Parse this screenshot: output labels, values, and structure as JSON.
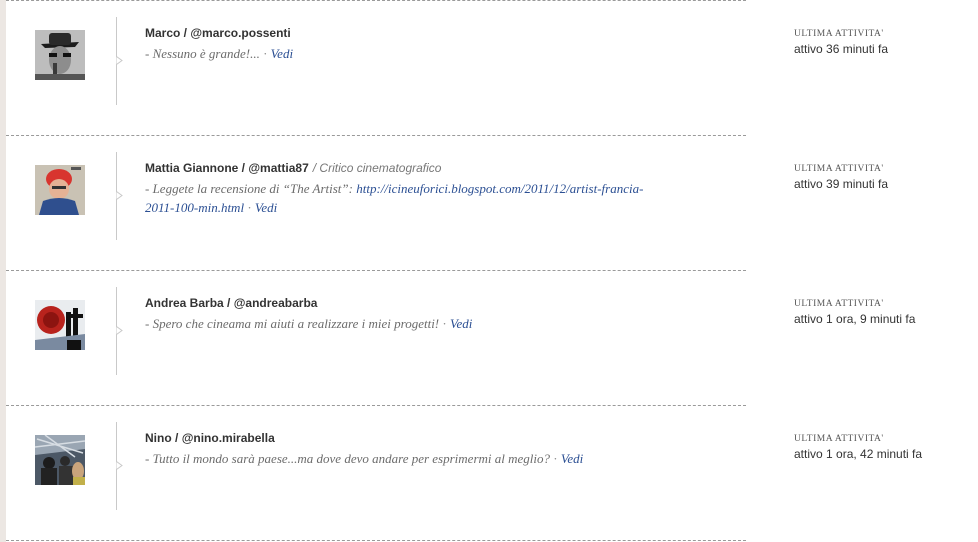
{
  "feed": {
    "activity_label": "ULTIMA ATTIVITA'",
    "items": [
      {
        "name": "Marco",
        "username": "@marco.possenti",
        "role": "",
        "message": "- Nessuno è grande!...",
        "link": "",
        "link_tail": "",
        "sep": "·",
        "view_label": "Vedi",
        "activity": "attivo 36 minuti fa",
        "avatar_icon": "hat-portrait-avatar"
      },
      {
        "name": "Mattia Giannone",
        "username": "@mattia87",
        "role": "/ Critico cinematografico",
        "message": "- Leggete la recensione di “The Artist”:",
        "link": "http://icineuforici.blogspot.com/2011/12/artist-francia-",
        "link_tail": "2011-100-min.html",
        "sep": "·",
        "view_label": "Vedi",
        "activity": "attivo 39 minuti fa",
        "avatar_icon": "red-beanie-avatar"
      },
      {
        "name": "Andrea Barba",
        "username": "@andreabarba",
        "role": "",
        "message": "- Spero che cineama mi aiuti a realizzare i miei progetti!",
        "link": "",
        "link_tail": "",
        "sep": "·",
        "view_label": "Vedi",
        "activity": "attivo 1 ora, 9 minuti fa",
        "avatar_icon": "red-logo-avatar"
      },
      {
        "name": "Nino",
        "username": "@nino.mirabella",
        "role": "",
        "message": "- Tutto il mondo sarà paese...ma dove devo andare per esprimermi al meglio?",
        "link": "",
        "link_tail": "",
        "sep": "·",
        "view_label": "Vedi",
        "activity": "attivo 1 ora, 42 minuti fa",
        "avatar_icon": "crowd-photo-avatar"
      }
    ]
  },
  "colors": {
    "link": "#2b4f93",
    "name": "#333333",
    "message": "#6b6b6b",
    "separator": "#9a9a9a"
  }
}
